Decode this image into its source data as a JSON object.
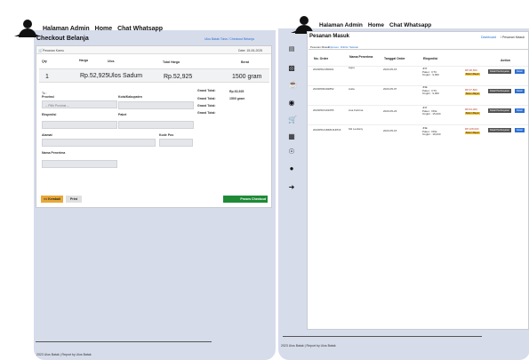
{
  "left": {
    "nav": {
      "admin": "Halaman Admin",
      "home": "Home",
      "chat": "Chat Whatsapp"
    },
    "page_title": "Checkout Belanja",
    "breadcrumb": "Ulos Batak Toba / Checkout Belanja",
    "subheader_left": "Pesanan Kamu",
    "subheader_right": "Date: 15-06-2025",
    "table_headers": {
      "qty": "Qty",
      "harga": "Harga",
      "ulos": "Ulos",
      "total": "Total Harga",
      "berat": "Berat"
    },
    "row": {
      "qty": "1",
      "harga": "Rp.52,925",
      "ulos": "Ulos Sadum",
      "total": "Rp.52,925",
      "berat": "1500 gram"
    },
    "form": {
      "to_label": "To :",
      "provinsi_label": "Provinsi",
      "provinsi_value": "-- Pilih Provinsi --",
      "kota_label": "Kota/Kabupaten",
      "ekspedisi_label": "Ekspedisi",
      "paket_label": "Paket",
      "alamat_label": "Alamat",
      "kodepos_label": "Kode Pos",
      "nama_label": "Nama Penerima"
    },
    "summary": {
      "gt1_label": "Grand Total:",
      "gt1_value": "Rp.52,925",
      "gt2_label": "Grand Total:",
      "gt2_value": "1500 gram",
      "gt3_label": "Grand Total:",
      "gt4_label": "Grand Total:"
    },
    "buttons": {
      "kembali": "<< Kembali",
      "print": "Print",
      "proses": "Proses Checkout"
    },
    "footer": "2023 Ulos Batak | Report by Ulos Batak"
  },
  "right": {
    "nav": {
      "admin": "Halaman Admin",
      "home": "Home",
      "chat": "Chat Whatsapp"
    },
    "page_title": "Pesanan Masuk",
    "breadcrumb_link": "Dashboard",
    "breadcrumb_current": "Pesanan Masuk",
    "filter_tabs": [
      "Pesanan Masuk",
      "Diproses",
      "Dikirim",
      "Selesai"
    ],
    "table_headers": {
      "no_order": "No. Order",
      "nama": "Nama Penerima",
      "tanggal": "Tanggal Order",
      "ekspedisi": "Ekspedisi",
      "action": "Action"
    },
    "rows": [
      {
        "no_order": "20230510150601",
        "nama": "Agus",
        "tanggal": "2023-05-15",
        "ekspedisi": "JNT\nPaket : CTC\nOngkir : 9,000",
        "total": "RP.38,500",
        "status": "Belum Bayar",
        "btn1": "Detail Pembayaran",
        "btn2": "Detail"
      },
      {
        "no_order": "20230509192852",
        "nama": "Aulia",
        "tanggal": "2023-05-07",
        "ekspedisi": "JNE\nPaket : CTC\nOngkir : 9,000",
        "total": "RP.37,800",
        "status": "Belum Bayar",
        "btn1": "Detail Pembayaran",
        "btn2": "Detail"
      },
      {
        "no_order": "20230516191055",
        "nama": "Ana Febrina",
        "tanggal": "2023-05-23",
        "ekspedisi": "JNT\nPaket : OKE\nOngkir : 15,000",
        "total": "RP.63,000",
        "status": "Belum Bayar",
        "btn1": "Detail Pembayaran",
        "btn2": "Detail"
      },
      {
        "no_order": "20230514184810UPDF",
        "nama": "Siti Lestiany",
        "tanggal": "2023-05-15",
        "ekspedisi": "JNE\nPaket : OKE\nOngkir : 18,000",
        "total": "RP.108,000",
        "status": "Belum Bayar",
        "btn1": "Detail Pembayaran",
        "btn2": "Detail"
      }
    ],
    "footer": "2023 Ulos Batak | Report by Ulos Batak"
  }
}
